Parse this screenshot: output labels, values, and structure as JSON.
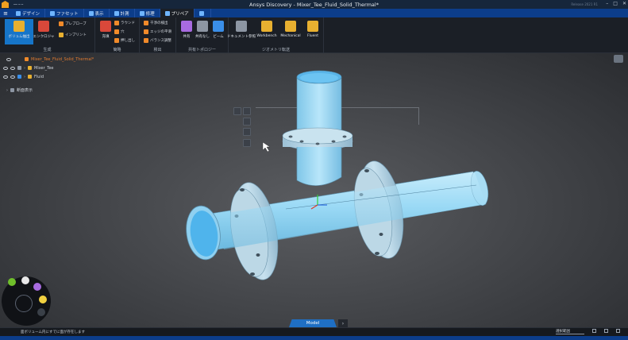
{
  "window": {
    "title": "Ansys Discovery - Mixer_Tee_Fluid_Solid_Thermal*",
    "version_label": "Release 2021 R1",
    "quick_access": "━━ ━ ━"
  },
  "tabs": [
    {
      "label": "デザイン",
      "active": false
    },
    {
      "label": "ファセット",
      "active": false
    },
    {
      "label": "表示",
      "active": false
    },
    {
      "label": "計測",
      "active": false
    },
    {
      "label": "修理",
      "active": false
    },
    {
      "label": "プリペア",
      "active": true
    },
    {
      "label": "",
      "active": false
    }
  ],
  "ribbon": {
    "groups": [
      {
        "label": "生成"
      },
      {
        "label": "簡略"
      },
      {
        "label": "検出"
      },
      {
        "label": "共有トポロジー"
      },
      {
        "label": "ジオメトリ転送"
      }
    ],
    "create": {
      "volume_label": "ボリュ",
      "extract_label": "ム抽出",
      "enclosure_label": "エンクロジャ",
      "prepare_label": "プレプローブ",
      "imprint_label": "インプリント"
    },
    "simplify": {
      "fill_label": "充填",
      "items": [
        "ラウンド",
        "穴",
        "押し出し"
      ]
    },
    "detect": {
      "items": [
        "干渉の検出",
        "エッジの平滑",
        "バランス調整"
      ]
    },
    "shared_topology": {
      "items": [
        "共有",
        "共有なし",
        "ビーム"
      ]
    },
    "geometry_transfer": {
      "items": [
        "ドキュメント参照",
        "Workbench",
        "Mechanical",
        "Fluent"
      ]
    }
  },
  "tree": {
    "root": "Mixer_Tee_Fluid_Solid_Thermal*",
    "items": [
      "Mixer_Tee",
      "Fluid"
    ],
    "section": "断面表示"
  },
  "model_tab": "Model",
  "status": {
    "message": "面ボリューム内にすでに面が存在します",
    "selection": "選択範囲"
  },
  "colors": {
    "accent": "#1675c9",
    "tab_bar": "#0c3d8a",
    "pipe_body": "#8fd3f2",
    "pipe_inner": "#4fb4ec",
    "flange": "#a7c9dd"
  }
}
